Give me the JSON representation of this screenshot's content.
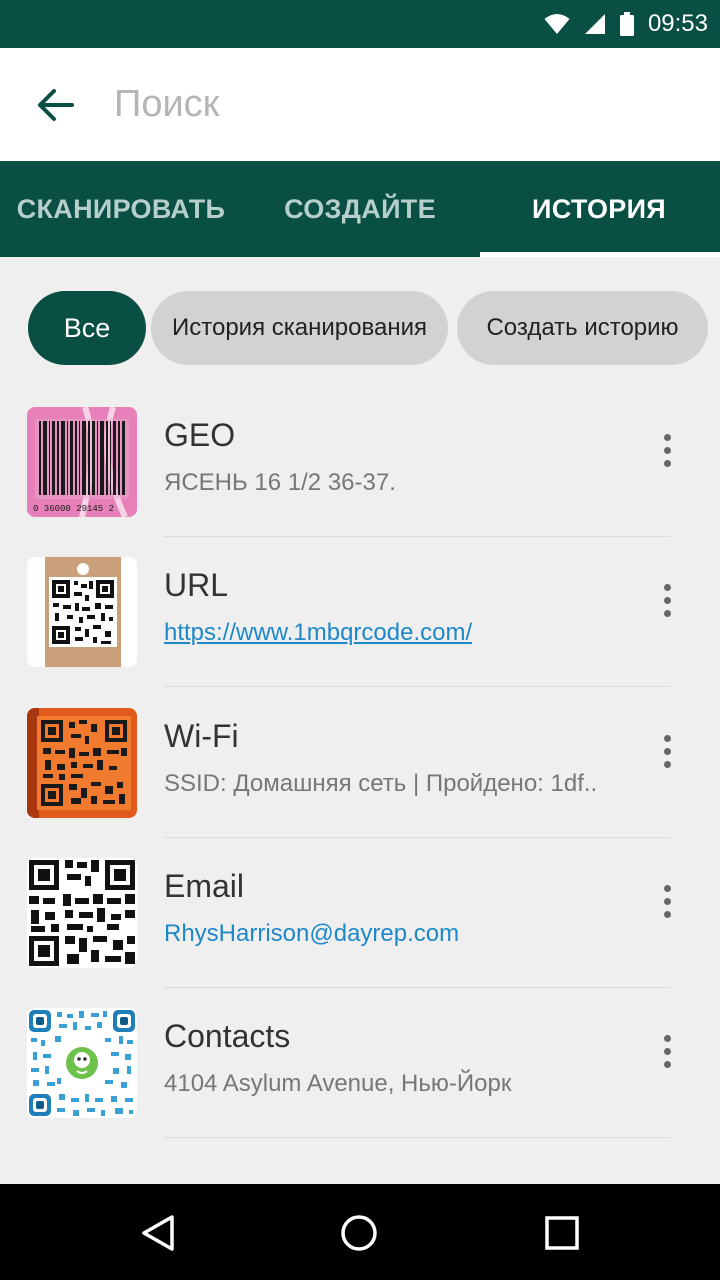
{
  "status_bar": {
    "time": "09:53",
    "icons": [
      "wifi-icon",
      "signal-icon",
      "battery-icon"
    ]
  },
  "search": {
    "placeholder": "Поиск",
    "value": ""
  },
  "tabs": [
    {
      "label": "СКАНИРОВАТЬ",
      "active": false
    },
    {
      "label": "СОЗДАЙТЕ",
      "active": false
    },
    {
      "label": "ИСТОРИЯ",
      "active": true
    }
  ],
  "filters": [
    {
      "label": "Все",
      "selected": true
    },
    {
      "label": "История сканирования",
      "selected": false
    },
    {
      "label": "Создать историю",
      "selected": false
    }
  ],
  "history": [
    {
      "title": "GEO",
      "subtitle": "ЯСЕНЬ 16 1/2 36-37.",
      "thumb": "barcode",
      "barcode_digits": "0 36000 29145 2"
    },
    {
      "title": "URL",
      "subtitle": "https://www.1mbqrcode.com/",
      "thumb": "qr-tag"
    },
    {
      "title": "Wi-Fi",
      "subtitle": "SSID: Домашняя сеть | Пройдено: 1df..",
      "thumb": "qr-orange"
    },
    {
      "title": "Email",
      "subtitle": "RhysHarrison@dayrep.com",
      "thumb": "qr-black"
    },
    {
      "title": "Contacts",
      "subtitle": "4104 Asylum Avenue, Нью-Йорк",
      "thumb": "qr-blue"
    }
  ],
  "colors": {
    "primary": "#0a4f43",
    "link": "#1e88c8",
    "chip": "#d2d2d2",
    "background": "#efefef"
  },
  "nav": [
    "back-icon",
    "home-icon",
    "recents-icon"
  ]
}
